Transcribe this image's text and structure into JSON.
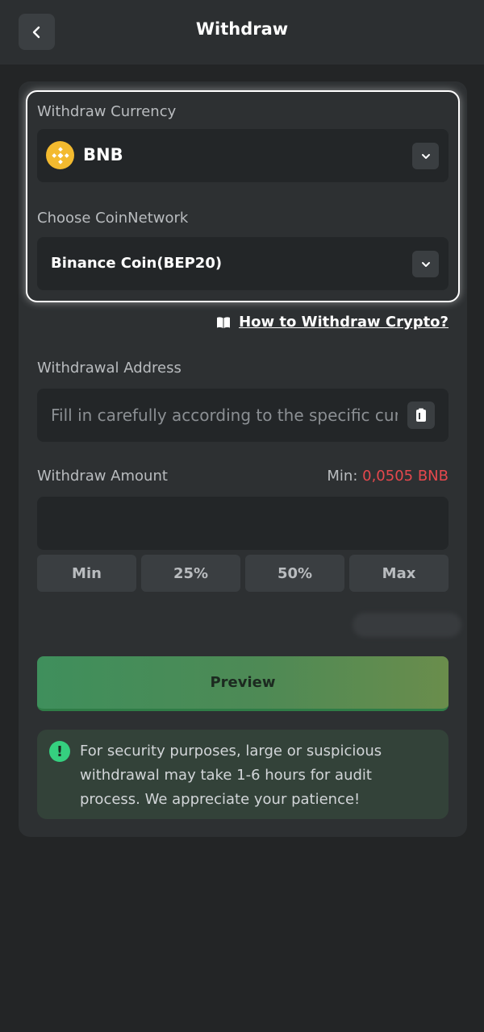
{
  "header": {
    "title": "Withdraw"
  },
  "currency": {
    "label": "Withdraw Currency",
    "selected": "BNB",
    "icon": "bnb-icon"
  },
  "network": {
    "label": "Choose CoinNetwork",
    "selected": "Binance Coin(BEP20)"
  },
  "help": {
    "link_text": "How to Withdraw Crypto?"
  },
  "address": {
    "label": "Withdrawal Address",
    "placeholder": "Fill in carefully according to the specific currency",
    "value": ""
  },
  "amount": {
    "label": "Withdraw Amount",
    "min_label": "Min:",
    "min_value": "0,0505 BNB",
    "value": "",
    "quick_buttons": [
      "Min",
      "25%",
      "50%",
      "Max"
    ]
  },
  "preview_label": "Preview",
  "notice": {
    "text": "For security purposes, large or suspicious withdrawal may take 1-6 hours for audit process. We appreciate your patience!"
  },
  "colors": {
    "accent_green": "#3f8f5c",
    "min_red": "#e5484d",
    "bnb_yellow": "#f3ba2f",
    "notice_icon": "#35d07f"
  }
}
